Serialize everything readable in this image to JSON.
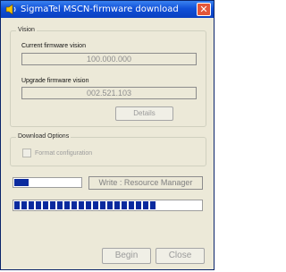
{
  "window": {
    "title": "SigmaTel MSCN-firmware download",
    "close_glyph": "✕"
  },
  "vision": {
    "legend": "Vision",
    "current_label": "Current firmware vision",
    "current_value": "100.000.000",
    "upgrade_label": "Upgrade firmware vision",
    "upgrade_value": "002.521.103",
    "details_button": "Details"
  },
  "download_options": {
    "legend": "Download Options",
    "format_checkbox_label": "Format configuration",
    "format_checked": false
  },
  "progress": {
    "step_fraction": 0.22,
    "status_text": "Write : Resource Manager",
    "overall_fraction": 0.76
  },
  "buttons": {
    "begin": "Begin",
    "close": "Close"
  },
  "colors": {
    "title_bar": "#1050d8",
    "progress_fill": "#0a2a9e",
    "dialog_bg": "#ece9d8"
  }
}
